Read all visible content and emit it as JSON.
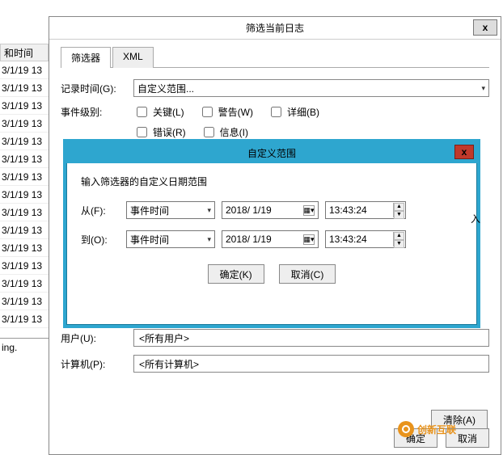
{
  "background": {
    "header": "和时间",
    "rows": [
      "3/1/19 13",
      "3/1/19 13",
      "3/1/19 13",
      "3/1/19 13",
      "3/1/19 13",
      "3/1/19 13",
      "3/1/19 13",
      "3/1/19 13",
      "3/1/19 13",
      "3/1/19 13",
      "3/1/19 13",
      "3/1/19 13",
      "3/1/19 13",
      "3/1/19 13",
      "3/1/19 13"
    ],
    "status": "ing."
  },
  "outer": {
    "title": "筛选当前日志",
    "close": "x",
    "tabs": {
      "filter": "筛选器",
      "xml": "XML"
    },
    "log_time_label": "记录时间(G):",
    "log_time_value": "自定义范围...",
    "level_label": "事件级别:",
    "levels": {
      "critical": "关键(L)",
      "warning": "警告(W)",
      "verbose": "详细(B)",
      "error": "错误(R)",
      "info": "信息(I)"
    },
    "user_label": "用户(U):",
    "user_value": "<所有用户>",
    "computer_label": "计算机(P):",
    "computer_value": "<所有计算机>",
    "clear": "清除(A)",
    "ok": "确定",
    "cancel": "取消"
  },
  "inner": {
    "title": "自定义范围",
    "close": "x",
    "hint": "输入筛选器的自定义日期范围",
    "from_label": "从(F):",
    "to_label": "到(O):",
    "event_time": "事件时间",
    "date": "2018/ 1/19",
    "time": "13:43:24",
    "ok": "确定(K)",
    "cancel": "取消(C)",
    "side_char": "入"
  },
  "logo": "创新互联"
}
